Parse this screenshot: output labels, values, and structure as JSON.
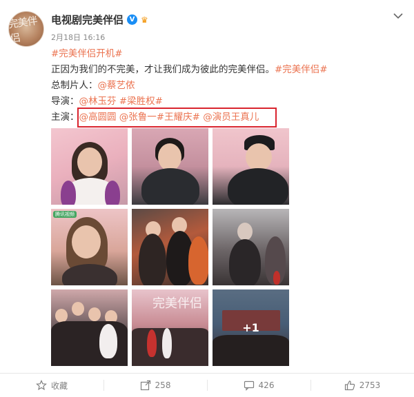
{
  "author": {
    "name": "电视剧完美伴侣",
    "avatar_text": "完美伴侣",
    "verified": true
  },
  "meta": {
    "date": "2月18日 16:16"
  },
  "post": {
    "line1_tag": "#完美伴侣开机#",
    "line2_text": "正因为我们的不完美，才让我们成为彼此的完美伴侣。",
    "line2_tag": "#完美伴侣#",
    "line3_label": "总制片人：",
    "line3_mention": "@蔡艺侬",
    "line4_label": "导演：",
    "line4_mention1": "@林玉芬",
    "line4_sep": " ",
    "line4_tag": "#梁胜权#",
    "line5_label": "主演：",
    "line5_mention1": "@高圆圆",
    "line5_mention2": "@张鲁一",
    "line5_tag": "#王耀庆#",
    "line5_mention3": "@演员王真儿"
  },
  "photos": {
    "more_label": "+1",
    "banner_text": "完美伴侣",
    "watermark": "腾讯视频"
  },
  "actions": {
    "favorite_label": "收藏",
    "share_count": "258",
    "comment_count": "426",
    "like_count": "2753"
  }
}
